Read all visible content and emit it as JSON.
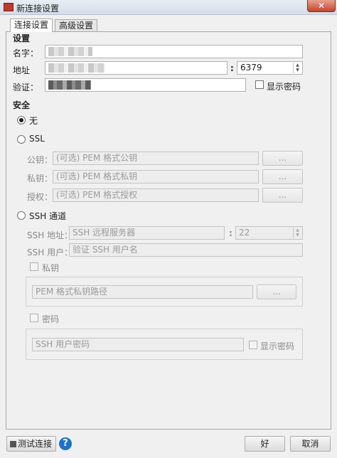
{
  "window": {
    "title": "新连接设置",
    "close_glyph": "✕"
  },
  "tabs": [
    {
      "label": "连接设置"
    },
    {
      "label": "高级设置"
    }
  ],
  "settings": {
    "heading": "设置",
    "name_label": "名字：",
    "address_label": "地址",
    "port_sep": ":",
    "port": "6379",
    "auth_label": "验证：",
    "show_password": "显示密码"
  },
  "security": {
    "heading": "安全",
    "none_label": "无",
    "ssl_label": "SSL",
    "pubkey_label": "公钥：",
    "pubkey_placeholder": "(可选) PEM 格式公钥",
    "privkey_label": "私钥：",
    "privkey_placeholder": "(可选) PEM 格式私钥",
    "auth_label": "授权：",
    "auth_placeholder": "(可选) PEM 格式授权",
    "browse": "...",
    "ssh_label": "SSH 通道",
    "ssh_address_label": "SSH 地址：",
    "ssh_address_placeholder": "SSH 远程服务器",
    "ssh_port_sep": ":",
    "ssh_port": "22",
    "ssh_user_label": "SSH 用户：",
    "ssh_user_placeholder": "验证 SSH 用户名",
    "private_key_label": "私钥",
    "private_key_placeholder": "PEM 格式私钥路径",
    "password_label": "密码",
    "password_placeholder": "SSH 用户密码",
    "show_password": "显示密码"
  },
  "footer": {
    "test_button": "测试连接",
    "help_glyph": "?",
    "ok_button": "好",
    "cancel_button": "取消"
  }
}
